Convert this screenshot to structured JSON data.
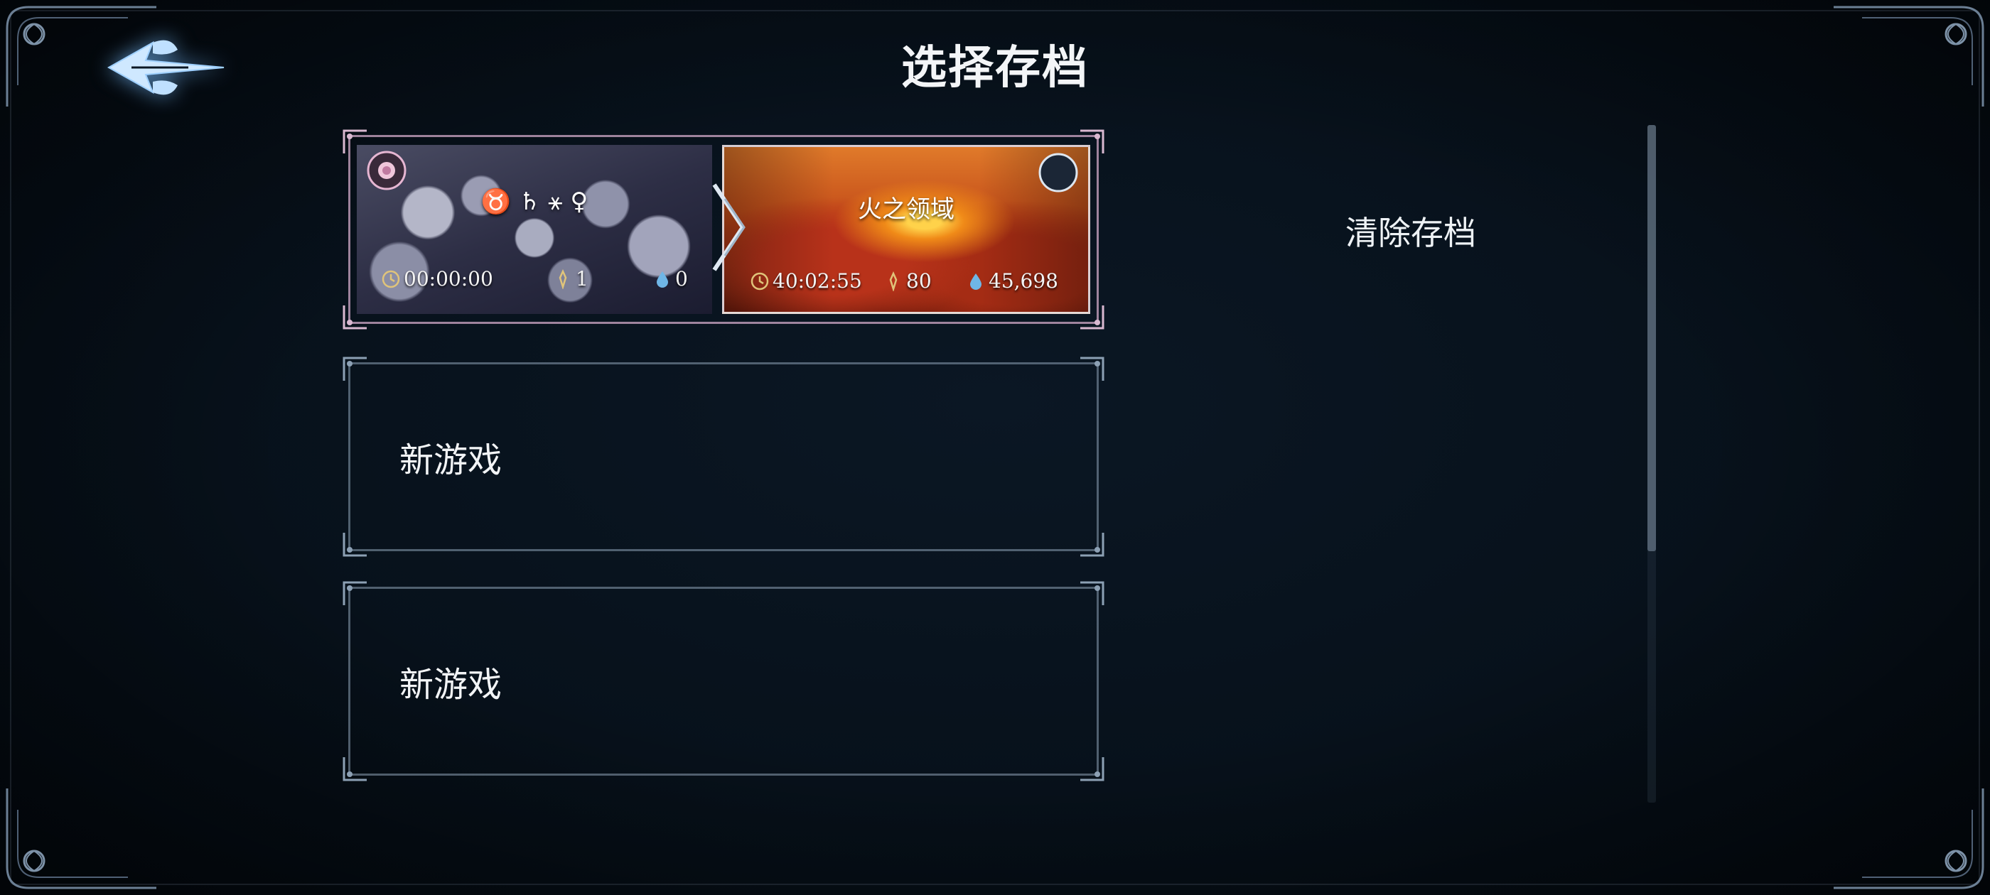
{
  "header": {
    "title": "选择存档"
  },
  "back_button": {
    "icon": "back-arrow-icon"
  },
  "side_actions": {
    "clear_label": "清除存档"
  },
  "slots": [
    {
      "type": "saved",
      "left": {
        "name": "♉ ♄ ⚹ ♀",
        "time": "00:00:00",
        "level": "1",
        "essence": "0"
      },
      "right": {
        "name": "火之领域",
        "time": "40:02:55",
        "level": "80",
        "essence": "45,698"
      }
    },
    {
      "type": "empty",
      "label": "新游戏"
    },
    {
      "type": "empty",
      "label": "新游戏"
    }
  ],
  "colors": {
    "background": "#07111b",
    "slot_border": "#8ca0b4",
    "active_border": "#d2aac8",
    "text": "#eef2f5",
    "glow": "#78beff"
  }
}
